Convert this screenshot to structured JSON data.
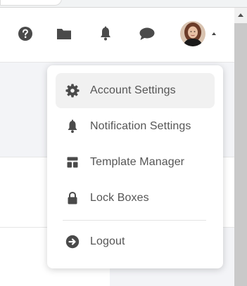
{
  "menu": {
    "items": [
      {
        "label": "Account Settings",
        "icon": "gear-icon",
        "active": true
      },
      {
        "label": "Notification Settings",
        "icon": "bell-icon",
        "active": false
      },
      {
        "label": "Template Manager",
        "icon": "template-icon",
        "active": false
      },
      {
        "label": "Lock Boxes",
        "icon": "lock-icon",
        "active": false
      },
      {
        "label": "Logout",
        "icon": "logout-icon",
        "active": false
      }
    ]
  },
  "header": {
    "icons": [
      "help-icon",
      "folder-icon",
      "bell-icon",
      "chat-icon"
    ],
    "avatar": "user-avatar"
  },
  "colors": {
    "icon": "#4a4a4a",
    "menu_text": "#555555",
    "active_bg": "#f1f1f1",
    "panel_bg": "#f3f4f7"
  }
}
